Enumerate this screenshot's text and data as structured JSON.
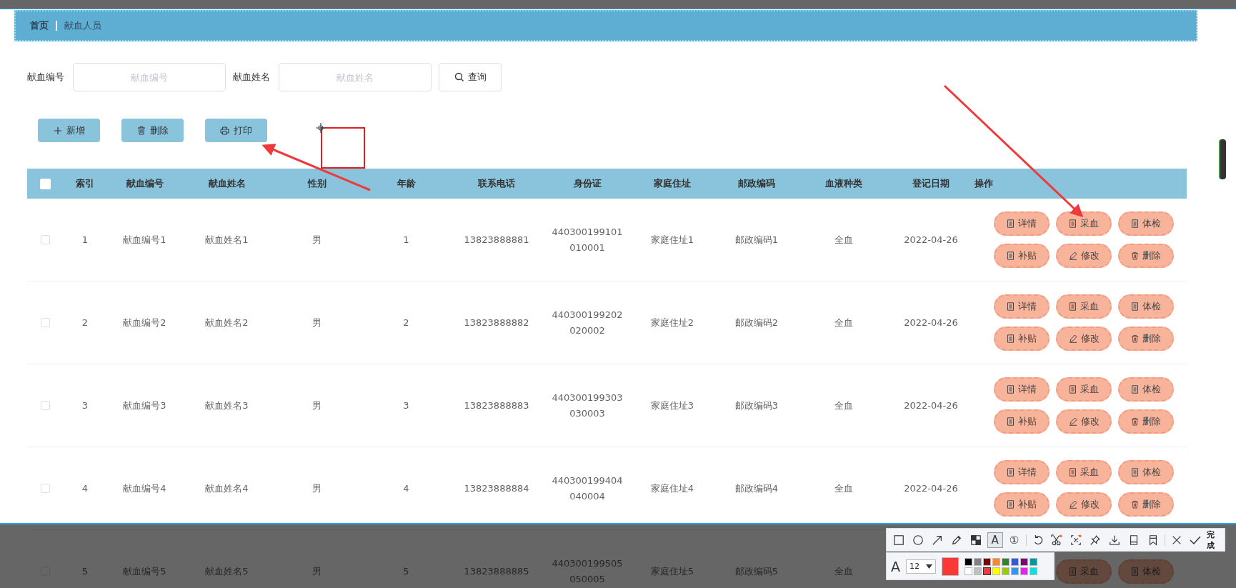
{
  "breadcrumb": [
    {
      "label": "首页",
      "current": false
    },
    {
      "label": "献血人员",
      "current": true
    }
  ],
  "search": {
    "fields": [
      {
        "label": "献血编号",
        "placeholder": "献血编号"
      },
      {
        "label": "献血姓名",
        "placeholder": "献血姓名"
      }
    ],
    "button": "查询"
  },
  "toolbar": [
    {
      "kind": "add",
      "label": "新增"
    },
    {
      "kind": "delete",
      "label": "删除"
    },
    {
      "kind": "print",
      "label": "打印"
    }
  ],
  "table": {
    "select_all": {
      "checked": false
    },
    "columns": [
      "索引",
      "献血编号",
      "献血姓名",
      "性别",
      "年龄",
      "联系电话",
      "身份证",
      "家庭住址",
      "邮政编码",
      "血液种类",
      "登记日期",
      "操作"
    ],
    "rows": [
      {
        "checked": false,
        "cells": [
          "1",
          "献血编号1",
          "献血姓名1",
          "男",
          "1",
          "13823888881",
          "440300199101010001",
          "家庭住址1",
          "邮政编码1",
          "全血",
          "2022-04-26"
        ],
        "actions": [
          {
            "kind": "doc",
            "label": "详情"
          },
          {
            "kind": "doc",
            "label": "采血"
          },
          {
            "kind": "doc",
            "label": "体检"
          },
          {
            "kind": "doc",
            "label": "补贴"
          },
          {
            "kind": "edit",
            "label": "修改"
          },
          {
            "kind": "delete",
            "label": "删除"
          }
        ]
      },
      {
        "checked": false,
        "cells": [
          "2",
          "献血编号2",
          "献血姓名2",
          "男",
          "2",
          "13823888882",
          "440300199202020002",
          "家庭住址2",
          "邮政编码2",
          "全血",
          "2022-04-26"
        ],
        "actions": [
          {
            "kind": "doc",
            "label": "详情"
          },
          {
            "kind": "doc",
            "label": "采血"
          },
          {
            "kind": "doc",
            "label": "体检"
          },
          {
            "kind": "doc",
            "label": "补贴"
          },
          {
            "kind": "edit",
            "label": "修改"
          },
          {
            "kind": "delete",
            "label": "删除"
          }
        ]
      },
      {
        "checked": false,
        "cells": [
          "3",
          "献血编号3",
          "献血姓名3",
          "男",
          "3",
          "13823888883",
          "440300199303030003",
          "家庭住址3",
          "邮政编码3",
          "全血",
          "2022-04-26"
        ],
        "actions": [
          {
            "kind": "doc",
            "label": "详情"
          },
          {
            "kind": "doc",
            "label": "采血"
          },
          {
            "kind": "doc",
            "label": "体检"
          },
          {
            "kind": "doc",
            "label": "补贴"
          },
          {
            "kind": "edit",
            "label": "修改"
          },
          {
            "kind": "delete",
            "label": "删除"
          }
        ]
      },
      {
        "checked": false,
        "cells": [
          "4",
          "献血编号4",
          "献血姓名4",
          "男",
          "4",
          "13823888884",
          "440300199404040004",
          "家庭住址4",
          "邮政编码4",
          "全血",
          "2022-04-26"
        ],
        "actions": [
          {
            "kind": "doc",
            "label": "详情"
          },
          {
            "kind": "doc",
            "label": "采血"
          },
          {
            "kind": "doc",
            "label": "体检"
          },
          {
            "kind": "doc",
            "label": "补贴"
          },
          {
            "kind": "edit",
            "label": "修改"
          },
          {
            "kind": "delete",
            "label": "删除"
          }
        ]
      },
      {
        "checked": false,
        "cells": [
          "5",
          "献血编号5",
          "献血姓名5",
          "男",
          "5",
          "13823888885",
          "440300199505050005",
          "家庭住址5",
          "邮政编码5",
          "全血"
        ],
        "actions": [
          {
            "kind": "doc",
            "label": "采血"
          },
          {
            "kind": "doc",
            "label": "体检"
          }
        ]
      }
    ]
  },
  "capture_toolbar": {
    "tools": [
      {
        "kind": "rect",
        "selected": false
      },
      {
        "kind": "circle",
        "selected": false
      },
      {
        "kind": "arrow",
        "selected": false
      },
      {
        "kind": "pencil",
        "selected": false
      },
      {
        "kind": "mosaic",
        "selected": false
      },
      {
        "kind": "text",
        "label": "A",
        "selected": true
      },
      {
        "kind": "number",
        "label": "①",
        "selected": false
      },
      {
        "kind": "sep"
      },
      {
        "kind": "undo",
        "selected": false
      },
      {
        "kind": "scissors",
        "selected": false
      },
      {
        "kind": "ocr",
        "selected": false
      },
      {
        "kind": "pin",
        "selected": false
      },
      {
        "kind": "download",
        "selected": false
      },
      {
        "kind": "phone",
        "selected": false
      },
      {
        "kind": "bookmark",
        "selected": false
      },
      {
        "kind": "sep"
      },
      {
        "kind": "close",
        "selected": false
      }
    ],
    "done": "完成",
    "font_label": "A",
    "font_size": "12",
    "palette": [
      {
        "color": "#000000",
        "selected": false
      },
      {
        "color": "#808080",
        "selected": false
      },
      {
        "color": "#800000",
        "selected": false
      },
      {
        "color": "#f7883a",
        "selected": false
      },
      {
        "color": "#308430",
        "selected": false
      },
      {
        "color": "#385ad3",
        "selected": false
      },
      {
        "color": "#800080",
        "selected": false
      },
      {
        "color": "#009999",
        "selected": false
      },
      {
        "color": "#ffffff",
        "selected": false
      },
      {
        "color": "#c0c0c0",
        "selected": false
      },
      {
        "color": "#fb3838",
        "selected": true
      },
      {
        "color": "#ffff00",
        "selected": false
      },
      {
        "color": "#99cc00",
        "selected": false
      },
      {
        "color": "#3894e4",
        "selected": false
      },
      {
        "color": "#f31bf3",
        "selected": false
      },
      {
        "color": "#16dcdc",
        "selected": false
      }
    ]
  }
}
